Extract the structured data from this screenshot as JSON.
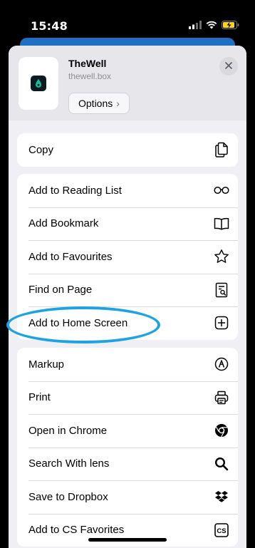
{
  "status": {
    "time": "15:48"
  },
  "header": {
    "site_title": "TheWell",
    "site_url": "thewell.box",
    "options_label": "Options"
  },
  "groups": [
    {
      "items": [
        {
          "label": "Copy",
          "icon": "copy-icon"
        }
      ]
    },
    {
      "items": [
        {
          "label": "Add to Reading List",
          "icon": "glasses-icon"
        },
        {
          "label": "Add Bookmark",
          "icon": "book-icon"
        },
        {
          "label": "Add to Favourites",
          "icon": "star-icon"
        },
        {
          "label": "Find on Page",
          "icon": "find-page-icon"
        },
        {
          "label": "Add to Home Screen",
          "icon": "plus-square-icon"
        }
      ]
    },
    {
      "items": [
        {
          "label": "Markup",
          "icon": "markup-icon"
        },
        {
          "label": "Print",
          "icon": "printer-icon"
        },
        {
          "label": "Open in Chrome",
          "icon": "chrome-icon"
        },
        {
          "label": "Search With lens",
          "icon": "search-icon"
        },
        {
          "label": "Save to Dropbox",
          "icon": "dropbox-icon"
        },
        {
          "label": "Add to CS Favorites",
          "icon": "cs-icon"
        }
      ]
    }
  ],
  "icons": {
    "cs_text": "CS"
  },
  "colors": {
    "highlight": "#1fa3e0",
    "site_icon_accent": "#1abc9c"
  }
}
